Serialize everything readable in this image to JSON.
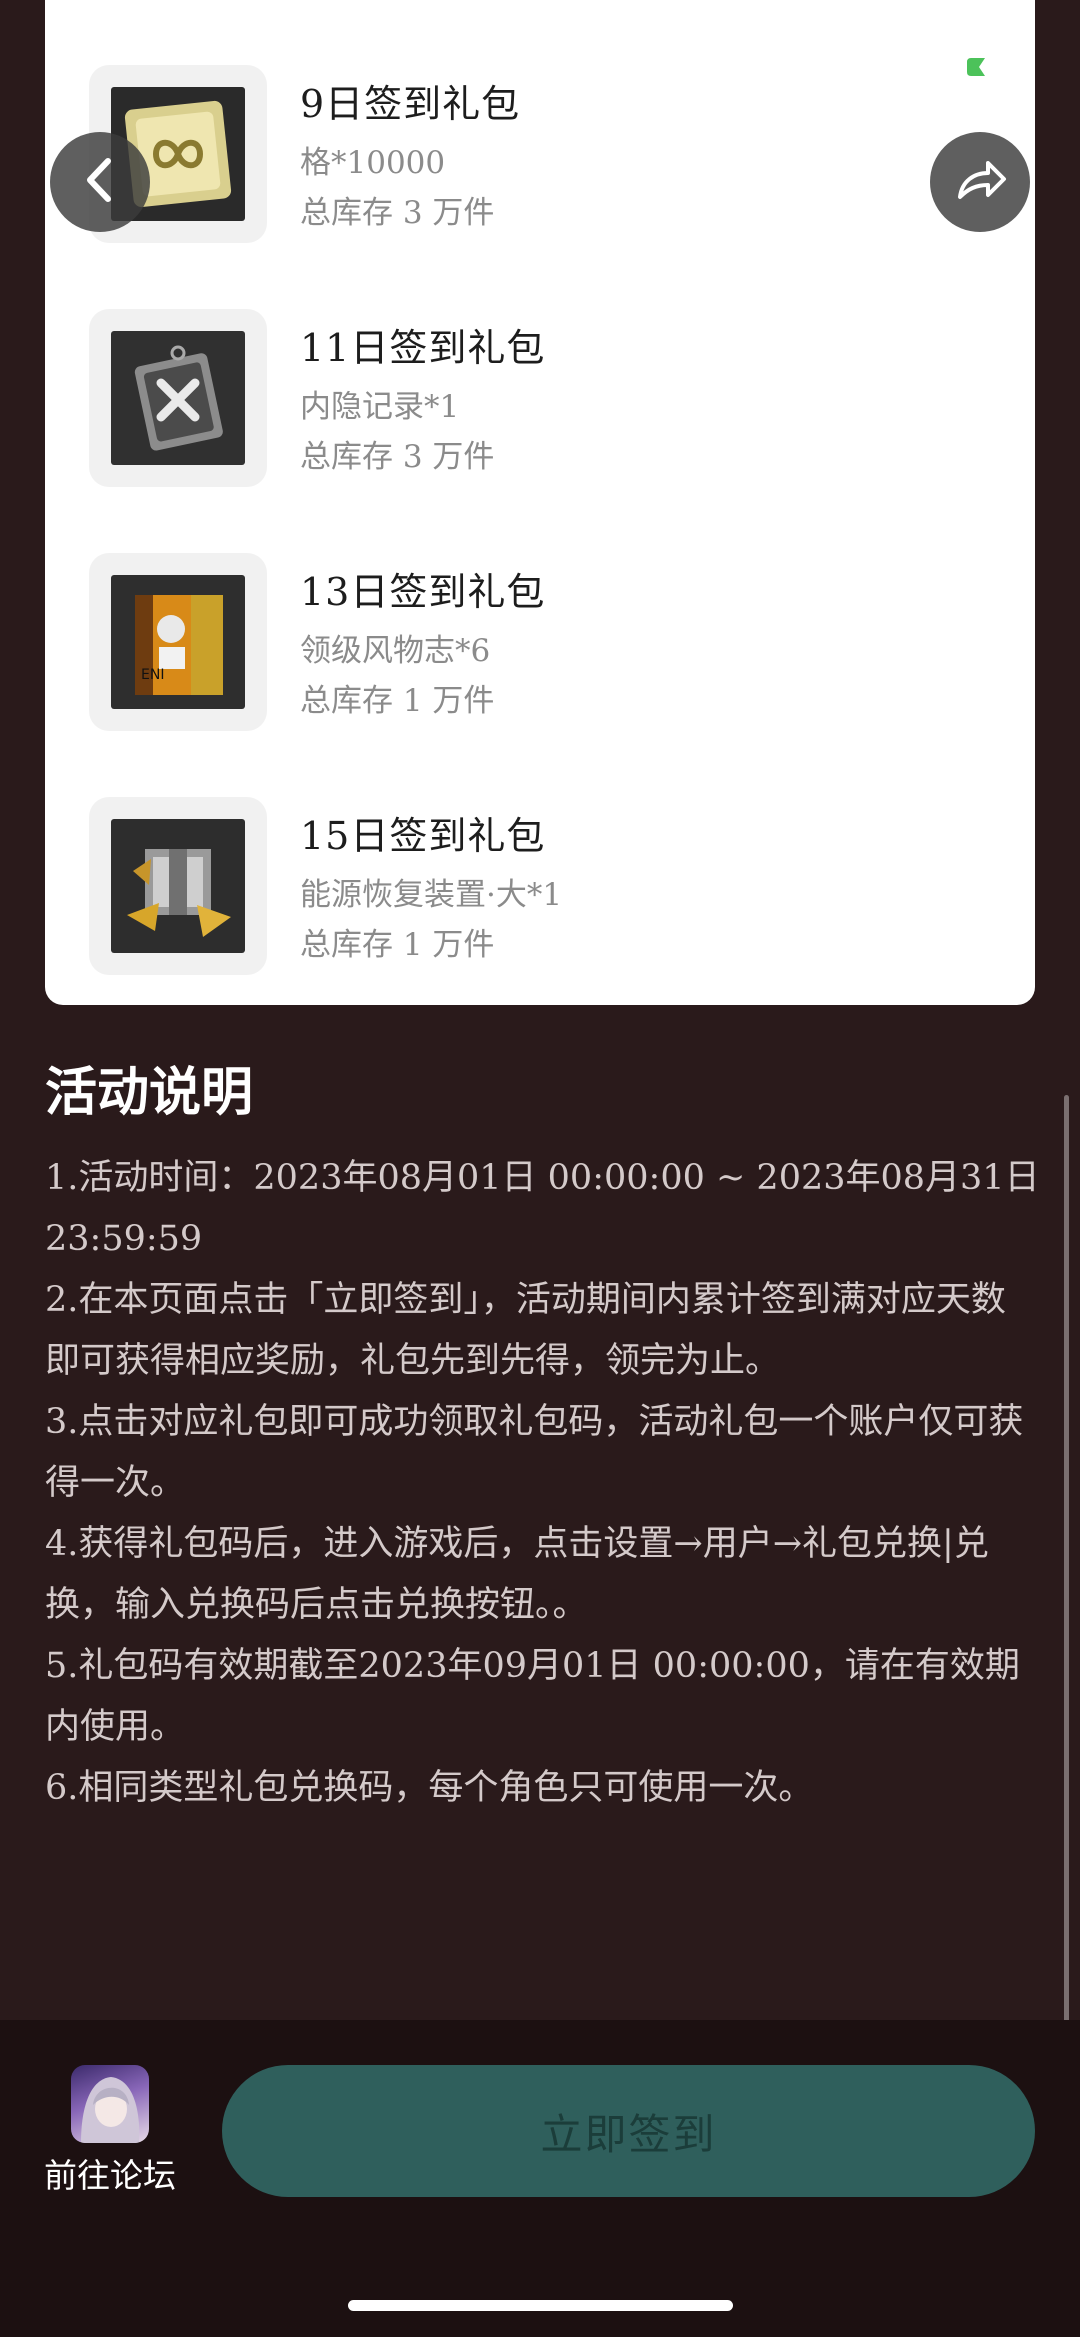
{
  "gifts": [
    {
      "title": "9日签到礼包",
      "item": "格*10000",
      "stock": "总库存 3 万件",
      "icon": "gold-infinity-chip-icon"
    },
    {
      "title": "11日签到礼包",
      "item": "内隐记录*1",
      "stock": "总库存 3 万件",
      "icon": "metal-record-icon"
    },
    {
      "title": "13日签到礼包",
      "item": "领级风物志*6",
      "stock": "总库存 1 万件",
      "icon": "yellow-book-icon"
    },
    {
      "title": "15日签到礼包",
      "item": "能源恢复装置·大*1",
      "stock": "总库存 1 万件",
      "icon": "energy-device-icon"
    }
  ],
  "nav": {
    "back_icon": "chevron-left-icon",
    "share_icon": "share-arrow-icon"
  },
  "rules": {
    "title": "活动说明",
    "items": [
      "1.活动时间：2023年08月01日 00:00:00 ~ 2023年08月31日 23:59:59",
      "2.在本页面点击「立即签到」，活动期间内累计签到满对应天数即可获得相应奖励，礼包先到先得，领完为止。",
      "3.点击对应礼包即可成功领取礼包码，活动礼包一个账户仅可获得一次。",
      "4.获得礼包码后，进入游戏后，点击设置→用户→礼包兑换|兑换，输入兑换码后点击兑换按钮。。",
      "5.礼包码有效期截至2023年09月01日 00:00:00，请在有效期内使用。",
      "6.相同类型礼包兑换码，每个角色只可使用一次。"
    ]
  },
  "bottom": {
    "forum_label": "前往论坛",
    "signin_label": "立即签到"
  },
  "colors": {
    "background": "#2a1a1b",
    "button": "#2f5f5c",
    "button_text": "#1b3d3a",
    "accent_green": "#4cc25a"
  }
}
